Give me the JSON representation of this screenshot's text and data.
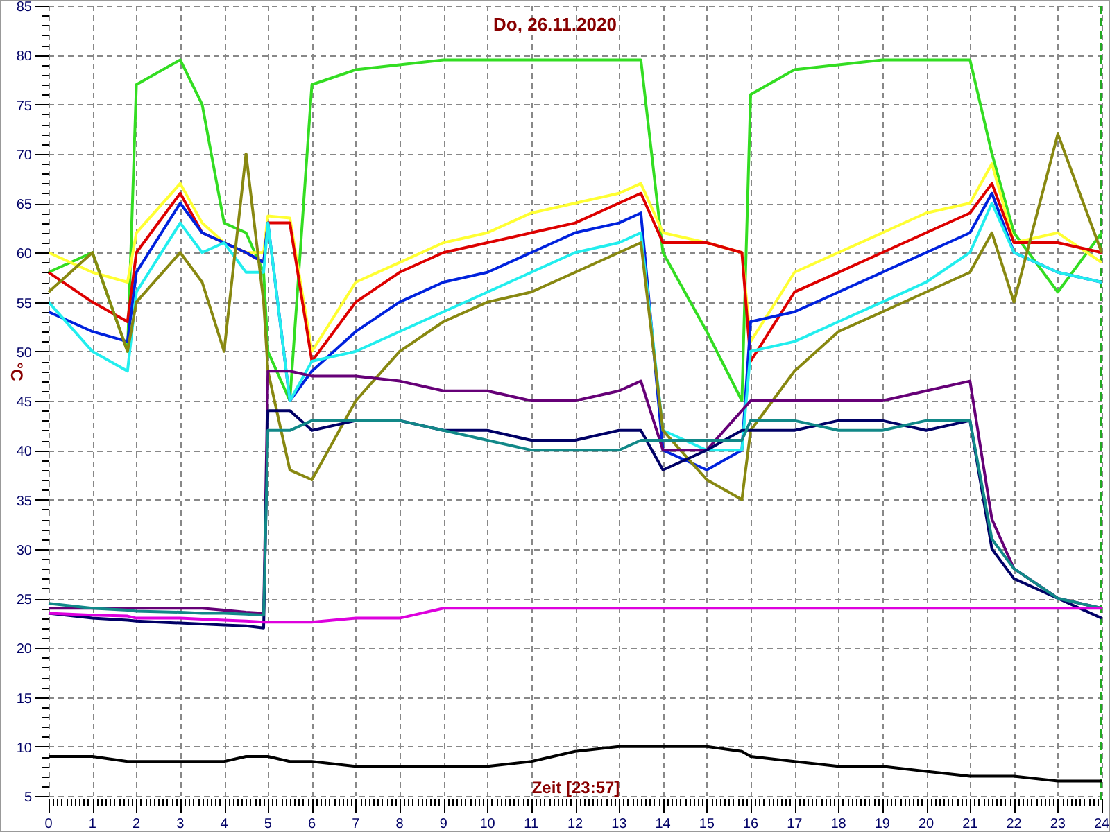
{
  "chart": {
    "chart_data": {
      "type": "line",
      "title": "Do, 26.11.2020",
      "xlabel": "Zeit [23:57]",
      "ylabel": "°C",
      "x": [
        0,
        1,
        1.8,
        2,
        3,
        3.5,
        4,
        4.5,
        4.9,
        5,
        5.5,
        6,
        7,
        8,
        9,
        10,
        11,
        12,
        13,
        13.5,
        14,
        15,
        15.8,
        16,
        17,
        18,
        19,
        20,
        21,
        21.5,
        22,
        23,
        24
      ],
      "series": [
        {
          "color": "#33dd22",
          "values": [
            58,
            60,
            50,
            77,
            79.5,
            75,
            63,
            62,
            58,
            50,
            45,
            77,
            78.5,
            79,
            79.5,
            79.5,
            79.5,
            79.5,
            79.5,
            79.5,
            60,
            52,
            45,
            76,
            78.5,
            79,
            79.5,
            79.5,
            79.5,
            70,
            62,
            56,
            62
          ]
        },
        {
          "color": "#ffff33",
          "values": [
            60,
            58,
            57,
            62,
            67,
            63,
            61,
            60,
            60,
            63.7,
            63.5,
            50,
            57,
            59,
            61,
            62,
            64,
            65,
            66,
            67,
            62,
            61,
            60,
            51,
            58,
            60,
            62,
            64,
            65,
            69,
            61,
            62,
            59
          ]
        },
        {
          "color": "#dd0000",
          "values": [
            58,
            55,
            53,
            60,
            66,
            62,
            61,
            60,
            59,
            63,
            63,
            49,
            55,
            58,
            60,
            61,
            62,
            63,
            65,
            66,
            61,
            61,
            60,
            49,
            56,
            58,
            60,
            62,
            64,
            67,
            61,
            61,
            60
          ]
        },
        {
          "color": "#0022dd",
          "values": [
            54,
            52,
            51,
            58,
            65,
            62,
            61,
            60,
            59,
            63,
            45,
            48,
            52,
            55,
            57,
            58,
            60,
            62,
            63,
            64,
            40,
            38,
            40,
            53,
            54,
            56,
            58,
            60,
            62,
            66,
            60,
            58,
            57
          ]
        },
        {
          "color": "#22eeee",
          "values": [
            55,
            50,
            48,
            56,
            63,
            60,
            61,
            58,
            58,
            63,
            45,
            49,
            50,
            52,
            54,
            56,
            58,
            60,
            61,
            62,
            42,
            40,
            40,
            50,
            51,
            53,
            55,
            57,
            60,
            65,
            60,
            58,
            57
          ]
        },
        {
          "color": "#888811",
          "values": [
            56,
            60,
            50,
            55,
            60,
            57,
            50,
            70,
            55,
            48,
            38,
            37,
            45,
            50,
            53,
            55,
            56,
            58,
            60,
            61,
            42,
            37,
            35,
            42,
            48,
            52,
            54,
            56,
            58,
            62,
            55,
            72,
            60
          ]
        },
        {
          "color": "#660077",
          "values": [
            24,
            24,
            24,
            24,
            24,
            24,
            23.8,
            23.6,
            23.5,
            48,
            48,
            47.5,
            47.5,
            47,
            46,
            46,
            45,
            45,
            46,
            47,
            40,
            40,
            44,
            45,
            45,
            45,
            45,
            46,
            47,
            33,
            28,
            25,
            24
          ]
        },
        {
          "color": "#000066",
          "values": [
            23.5,
            23,
            22.8,
            22.7,
            22.5,
            22.4,
            22.3,
            22.2,
            22,
            44,
            44,
            42,
            43,
            43,
            42,
            42,
            41,
            41,
            42,
            42,
            38,
            40,
            42,
            42,
            42,
            43,
            43,
            42,
            43,
            30,
            27,
            25,
            23
          ]
        },
        {
          "color": "#118888",
          "values": [
            24.5,
            24,
            23.8,
            23.7,
            23.6,
            23.5,
            23.5,
            23.4,
            23.3,
            42,
            42,
            43,
            43,
            43,
            42,
            41,
            40,
            40,
            40,
            41,
            41,
            41,
            41,
            43,
            43,
            42,
            42,
            43,
            43,
            31,
            28,
            25,
            24
          ]
        },
        {
          "color": "#dd00dd",
          "values": [
            23.5,
            23.3,
            23.2,
            23,
            23,
            22.9,
            22.8,
            22.7,
            22.6,
            22.6,
            22.6,
            22.6,
            23,
            23,
            24,
            24,
            24,
            24,
            24,
            24,
            24,
            24,
            24,
            24,
            24,
            24,
            24,
            24,
            24,
            24,
            24,
            24,
            24
          ]
        },
        {
          "color": "#000000",
          "values": [
            9,
            9,
            8.5,
            8.5,
            8.5,
            8.5,
            8.5,
            9,
            9,
            9,
            8.5,
            8.5,
            8,
            8,
            8,
            8,
            8.5,
            9.5,
            10,
            10,
            10,
            10,
            9.5,
            9,
            8.5,
            8,
            8,
            7.5,
            7,
            7,
            7,
            6.5,
            6.5
          ]
        }
      ],
      "grid": true,
      "xlim": [
        0,
        24
      ],
      "ylim": [
        5,
        85
      ],
      "xticks": [
        0,
        1,
        2,
        3,
        4,
        5,
        6,
        7,
        8,
        9,
        10,
        11,
        12,
        13,
        14,
        15,
        16,
        17,
        18,
        19,
        20,
        21,
        22,
        23,
        24
      ],
      "yticks": [
        5,
        10,
        15,
        20,
        25,
        30,
        35,
        40,
        45,
        50,
        55,
        60,
        65,
        70,
        75,
        80,
        85
      ]
    }
  }
}
